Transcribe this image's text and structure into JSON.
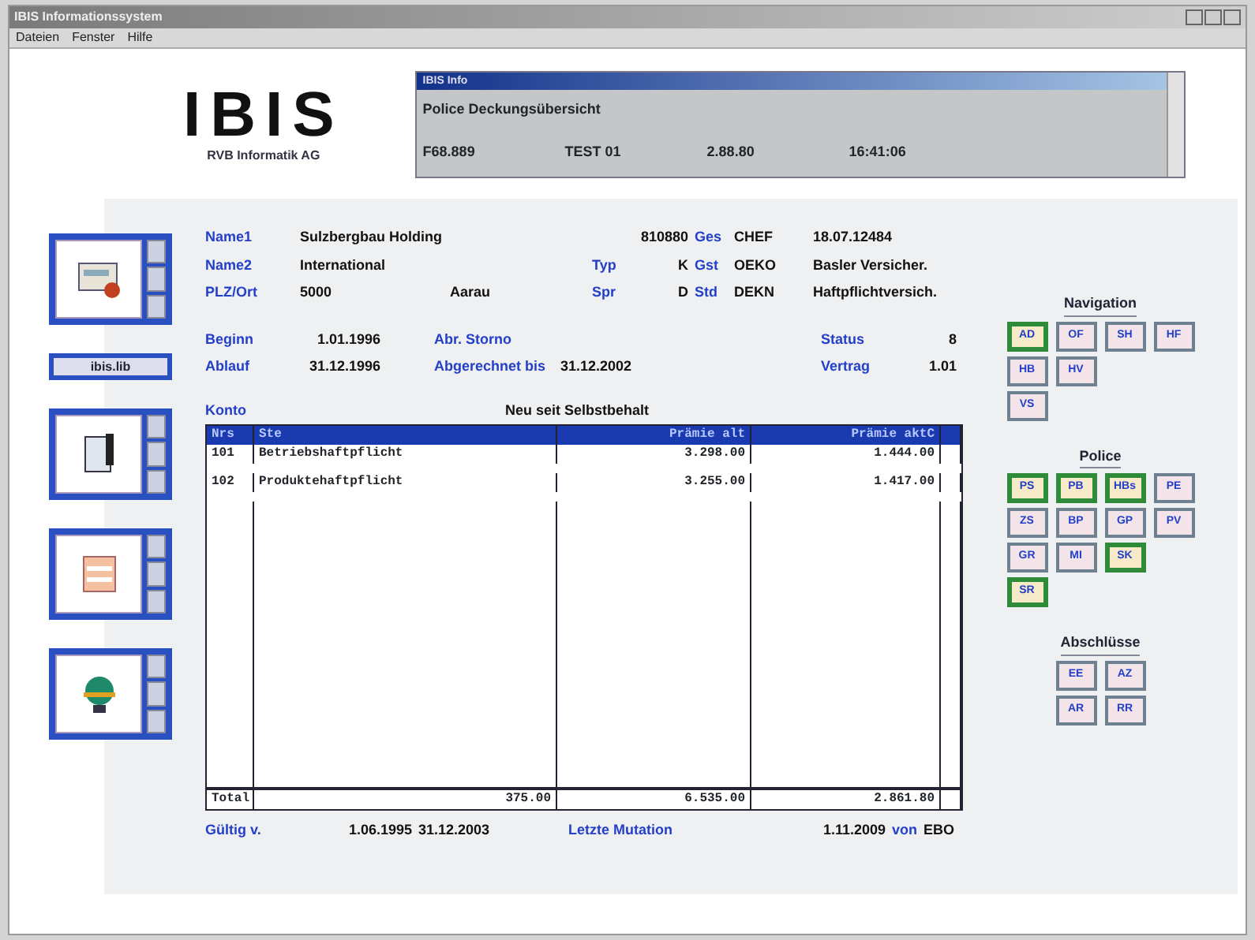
{
  "window": {
    "title": "IBIS Informationssystem"
  },
  "menu": [
    "Dateien",
    "Fenster",
    "Hilfe"
  ],
  "logo": {
    "text": "IBIS",
    "subtitle": "RVB Informatik AG"
  },
  "info_panel": {
    "title": "IBIS Info",
    "heading": "Police Deckungsübersicht",
    "values": [
      "F68.889",
      "TEST 01",
      "2.88.80",
      "16:41:06"
    ]
  },
  "side_tools": [
    {
      "kind": "panel"
    },
    {
      "kind": "button",
      "label": "ibis.lib"
    },
    {
      "kind": "panel"
    },
    {
      "kind": "panel"
    },
    {
      "kind": "panel"
    }
  ],
  "customer": [
    {
      "label": "Name1",
      "value": "Sulzbergbau Holding",
      "code": "810880",
      "tag_label": "Ges",
      "tag": "CHEF",
      "note": "18.07.12484"
    },
    {
      "label": "Name2",
      "value": "International",
      "code_label": "Typ",
      "code": "K",
      "tag_label": "Gst",
      "tag": "OEKO",
      "note": "Basler Versicher."
    },
    {
      "label": "PLZ/Ort",
      "value": "5000",
      "value2": "Aarau",
      "code_label": "Spr",
      "code": "D",
      "tag_label": "Std",
      "tag": "DEKN",
      "note": "Haftpflichtversich."
    }
  ],
  "contract": [
    {
      "label": "Beginn",
      "value": "1.01.1996",
      "label2": "Abr. Storno",
      "label3": "Status",
      "value3": "8"
    },
    {
      "label": "Ablauf",
      "value": "31.12.1996",
      "label2": "Abgerechnet bis",
      "value2": "31.12.2002",
      "label3": "Vertrag",
      "value3": "1.01"
    }
  ],
  "table": {
    "caption_left": "Konto",
    "caption": "Neu seit Selbstbehalt",
    "columns": [
      "Nrs",
      "Ste",
      "Prämie alt",
      "Prämie aktC"
    ],
    "rows": [
      [
        "101",
        "Betriebshaftpflicht",
        "3.298.00",
        "1.444.00"
      ],
      [
        "102",
        "Produktehaftpflicht",
        "3.255.00",
        "1.417.00"
      ]
    ],
    "totals": [
      "Total",
      "375.00",
      "6.535.00",
      "2.861.80"
    ]
  },
  "footer": {
    "valid_label": "Gültig v.",
    "valid_from": "1.06.1995",
    "valid_to": "31.12.2003",
    "mutation_label": "Letzte Mutation",
    "mutation_date": "1.11.2009",
    "by_label": "von",
    "by": "EBO"
  },
  "button_groups": [
    {
      "title": "Navigation",
      "rows": [
        [
          {
            "label": "AD",
            "active": true
          },
          {
            "label": "OF",
            "active": false
          },
          {
            "label": "SH",
            "active": false
          },
          {
            "label": "HF",
            "active": false
          }
        ],
        [
          {
            "label": "HB",
            "active": false
          },
          {
            "label": "HV",
            "active": false
          }
        ],
        [
          {
            "label": "VS",
            "active": false
          }
        ]
      ]
    },
    {
      "title": "Police",
      "rows": [
        [
          {
            "label": "PS",
            "active": true
          },
          {
            "label": "PB",
            "active": true
          },
          {
            "label": "HBs",
            "active": true
          },
          {
            "label": "PE",
            "active": false
          }
        ],
        [
          {
            "label": "ZS",
            "active": false
          },
          {
            "label": "BP",
            "active": false
          },
          {
            "label": "GP",
            "active": false
          },
          {
            "label": "PV",
            "active": false
          }
        ],
        [
          {
            "label": "GR",
            "active": false
          },
          {
            "label": "MI",
            "active": false
          },
          {
            "label": "SK",
            "active": true
          }
        ],
        [
          {
            "label": "SR",
            "active": true
          }
        ]
      ]
    },
    {
      "title": "Abschlüsse",
      "rows": [
        [
          {
            "label": "EE",
            "active": false
          },
          {
            "label": "AZ",
            "active": false
          }
        ],
        [
          {
            "label": "AR",
            "active": false
          },
          {
            "label": "RR",
            "active": false
          }
        ]
      ]
    }
  ]
}
